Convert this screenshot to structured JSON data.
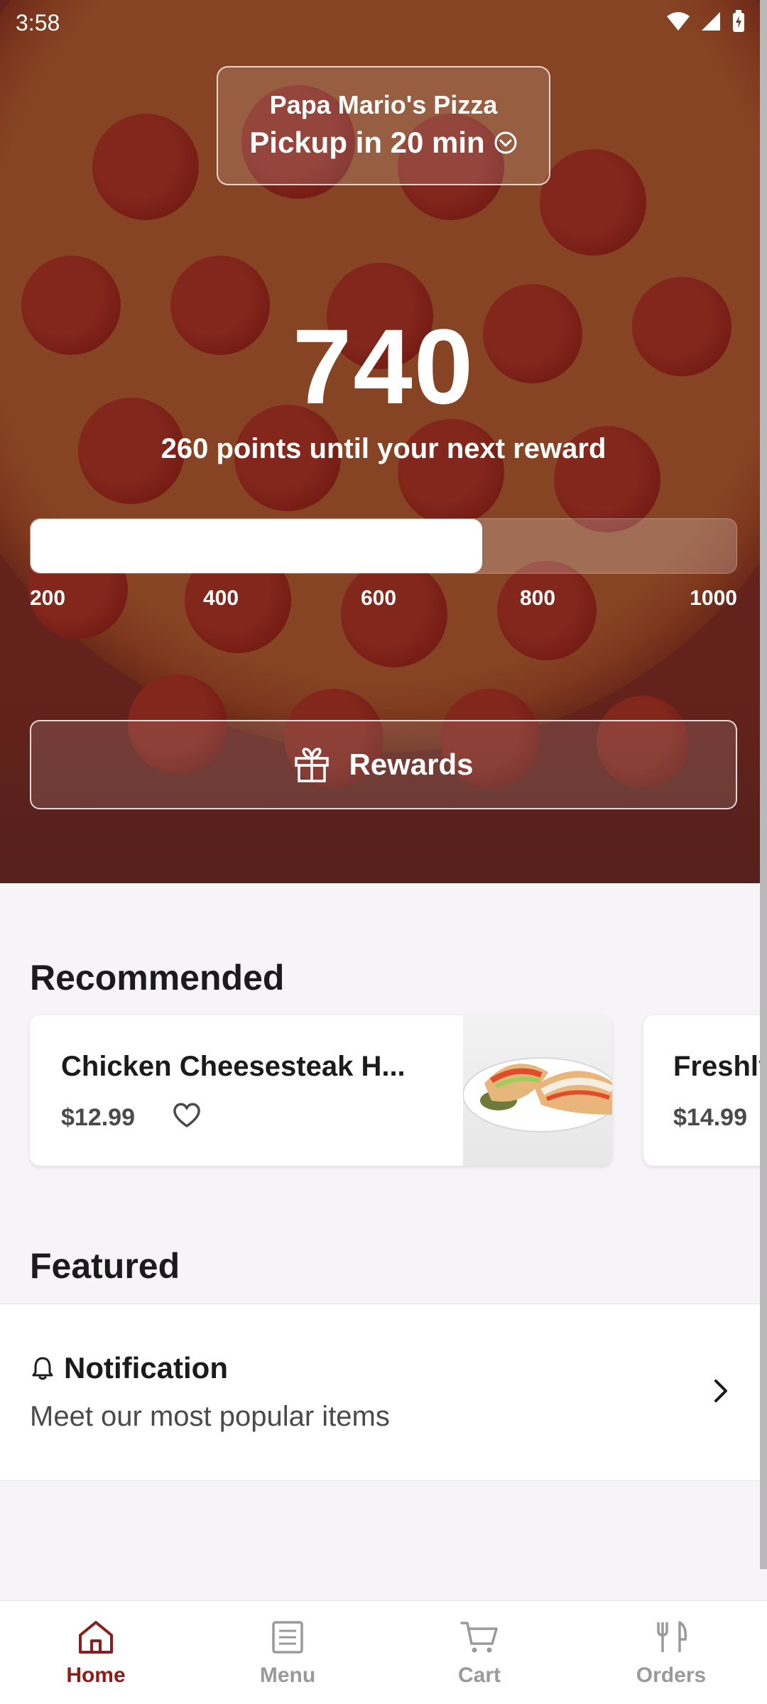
{
  "status_bar": {
    "time": "3:58"
  },
  "store": {
    "name": "Papa Mario's Pizza",
    "pickup": "Pickup in 20 min"
  },
  "rewards": {
    "points": "740",
    "subtitle": "260 points until your next reward",
    "progress_fraction": 0.64,
    "ticks": [
      "200",
      "400",
      "600",
      "800",
      "1000"
    ],
    "button_label": "Rewards"
  },
  "recommended": {
    "title": "Recommended",
    "items": [
      {
        "name": "Chicken Cheesesteak H...",
        "price": "$12.99"
      },
      {
        "name": "Freshly",
        "price": "$14.99"
      }
    ]
  },
  "featured": {
    "title": "Featured",
    "notification_title": "Notification",
    "notification_sub": "Meet our most popular items"
  },
  "nav": {
    "items": [
      {
        "label": "Home",
        "icon": "home-icon"
      },
      {
        "label": "Menu",
        "icon": "menu-icon"
      },
      {
        "label": "Cart",
        "icon": "cart-icon"
      },
      {
        "label": "Orders",
        "icon": "orders-icon"
      }
    ],
    "active_color": "#8c1d1a",
    "inactive_color": "#9a9a9a"
  }
}
